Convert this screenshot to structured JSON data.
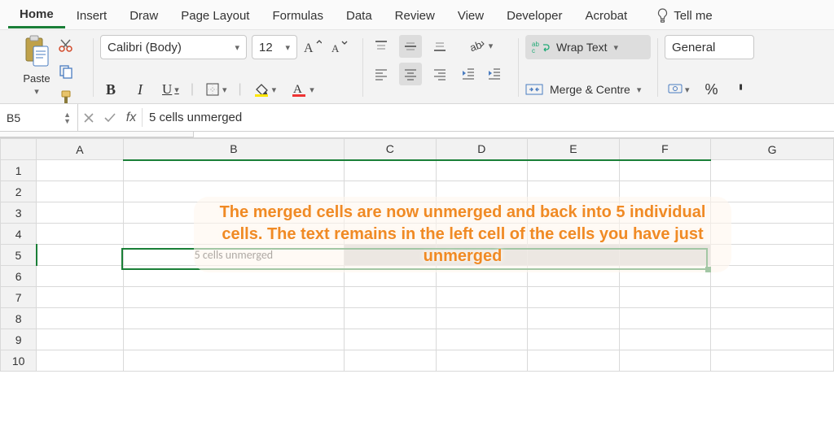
{
  "tabs": {
    "home": "Home",
    "insert": "Insert",
    "draw": "Draw",
    "page_layout": "Page Layout",
    "formulas": "Formulas",
    "data": "Data",
    "review": "Review",
    "view": "View",
    "developer": "Developer",
    "acrobat": "Acrobat",
    "tellme": "Tell me"
  },
  "clipboard": {
    "paste": "Paste"
  },
  "font": {
    "name": "Calibri (Body)",
    "size": "12",
    "bold": "B",
    "italic": "I",
    "underline": "U"
  },
  "alignment": {
    "wrap_text": "Wrap Text",
    "merge_centre": "Merge & Centre"
  },
  "number": {
    "format": "General",
    "percent": "%"
  },
  "name_box": "B5",
  "formula_prefix": "fx",
  "formula": "5 cells unmerged",
  "columns": [
    "A",
    "B",
    "C",
    "D",
    "E",
    "F",
    "G"
  ],
  "rows": [
    "1",
    "2",
    "3",
    "4",
    "5",
    "6",
    "7",
    "8",
    "9",
    "10"
  ],
  "cell_b5": "5 cells unmerged",
  "annotation": "The merged cells are now unmerged and back into 5 individual cells. The text remains in the left cell of the cells you have just unmerged"
}
